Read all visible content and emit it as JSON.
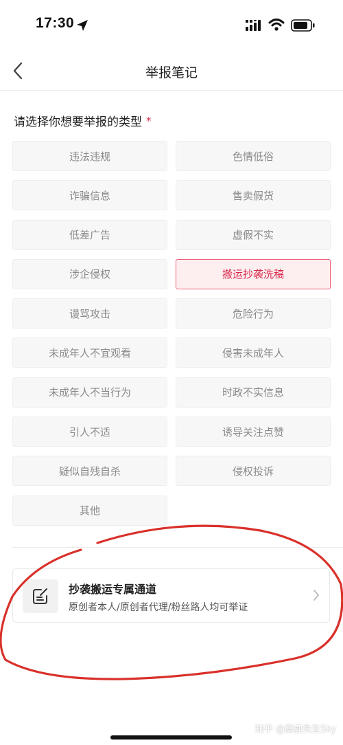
{
  "status_bar": {
    "time": "17:30"
  },
  "nav": {
    "title": "举报笔记"
  },
  "section": {
    "title": "请选择你想要举报的类型",
    "required_mark": "*"
  },
  "options": [
    {
      "label": "违法违规",
      "selected": false
    },
    {
      "label": "色情低俗",
      "selected": false
    },
    {
      "label": "诈骗信息",
      "selected": false
    },
    {
      "label": "售卖假货",
      "selected": false
    },
    {
      "label": "低差广告",
      "selected": false
    },
    {
      "label": "虚假不实",
      "selected": false
    },
    {
      "label": "涉企侵权",
      "selected": false
    },
    {
      "label": "搬运抄袭洗稿",
      "selected": true
    },
    {
      "label": "谩骂攻击",
      "selected": false
    },
    {
      "label": "危险行为",
      "selected": false
    },
    {
      "label": "未成年人不宜观看",
      "selected": false
    },
    {
      "label": "侵害未成年人",
      "selected": false
    },
    {
      "label": "未成年人不当行为",
      "selected": false
    },
    {
      "label": "时政不实信息",
      "selected": false
    },
    {
      "label": "引人不适",
      "selected": false
    },
    {
      "label": "诱导关注点赞",
      "selected": false
    },
    {
      "label": "疑似自残自杀",
      "selected": false
    },
    {
      "label": "侵权投诉",
      "selected": false
    },
    {
      "label": "其他",
      "selected": false
    }
  ],
  "channel": {
    "title": "抄袭搬运专属通道",
    "subtitle": "原创者本人/原创者代理/粉丝路人均可举证",
    "icon": "edit-note-icon"
  },
  "watermark": "知乎 @麋鹿先生Sky",
  "colors": {
    "accent": "#e0294a",
    "selected_bg": "#fdeef0",
    "annotation_red": "#d9302a"
  }
}
